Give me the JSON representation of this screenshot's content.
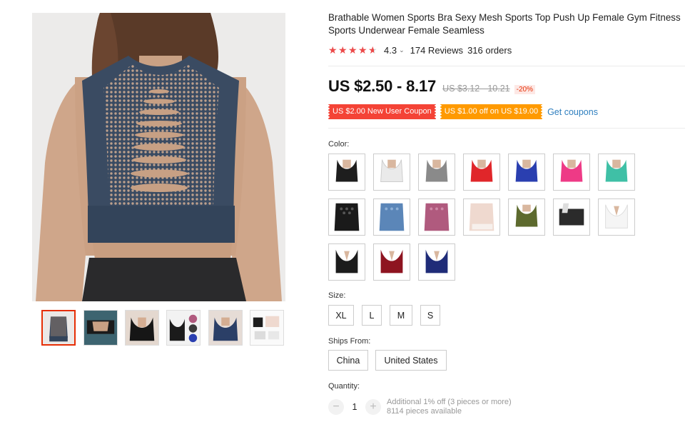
{
  "product": {
    "title": "Brathable Women Sports Bra Sexy Mesh Sports Top Push Up Female Gym Fitness Sports Underwear Female Seamless",
    "rating": "4.3",
    "reviews": "174 Reviews",
    "orders": "316 orders",
    "price_current": "US $2.50 - 8.17",
    "price_original": "US $3.12 - 10.21",
    "discount": "-20%"
  },
  "coupons": {
    "new_user": "US $2.00 New User Coupon",
    "off": "US $1.00 off on US $19.00",
    "get_link": "Get coupons"
  },
  "color": {
    "label": "Color:",
    "swatches": [
      {
        "name": "black",
        "color": "#1e1e1e"
      },
      {
        "name": "white",
        "color": "#f2f2f2"
      },
      {
        "name": "gray",
        "color": "#8a8a8a"
      },
      {
        "name": "red",
        "color": "#e0262a"
      },
      {
        "name": "blue",
        "color": "#2a3fb0"
      },
      {
        "name": "pink",
        "color": "#ee3a86"
      },
      {
        "name": "mint",
        "color": "#3fc0a6"
      },
      {
        "name": "black-mesh",
        "color": "#1a1a1a"
      },
      {
        "name": "light-blue",
        "color": "#5b86b8"
      },
      {
        "name": "mauve",
        "color": "#b05a7e"
      },
      {
        "name": "nude-mesh",
        "color": "#efd9cf"
      },
      {
        "name": "army-green",
        "color": "#5d6a2e"
      },
      {
        "name": "black-white",
        "color": "#2b2b2b"
      },
      {
        "name": "white-plunge",
        "color": "#f5f5f5"
      },
      {
        "name": "black-plunge",
        "color": "#1c1c1c"
      },
      {
        "name": "wine-red",
        "color": "#8e1420"
      },
      {
        "name": "navy",
        "color": "#1f2c78"
      }
    ]
  },
  "size": {
    "label": "Size:",
    "options": [
      "XL",
      "L",
      "M",
      "S"
    ]
  },
  "ships": {
    "label": "Ships From:",
    "options": [
      "China",
      "United States"
    ]
  },
  "quantity": {
    "label": "Quantity:",
    "minus": "−",
    "value": "1",
    "plus": "+",
    "note1": "Additional 1% off (3 pieces or more)",
    "note2": "8114 pieces available"
  },
  "gallery": {
    "thumbnails": [
      "back-mesh",
      "mesh-detail",
      "front-black",
      "color-set",
      "blue-front",
      "packaging"
    ]
  },
  "colors": {
    "accent_red": "#e62e04",
    "coupon_red": "#f44336",
    "coupon_orange": "#ff9a00",
    "link_blue": "#2f7fbf",
    "star": "#ec4a4a"
  }
}
